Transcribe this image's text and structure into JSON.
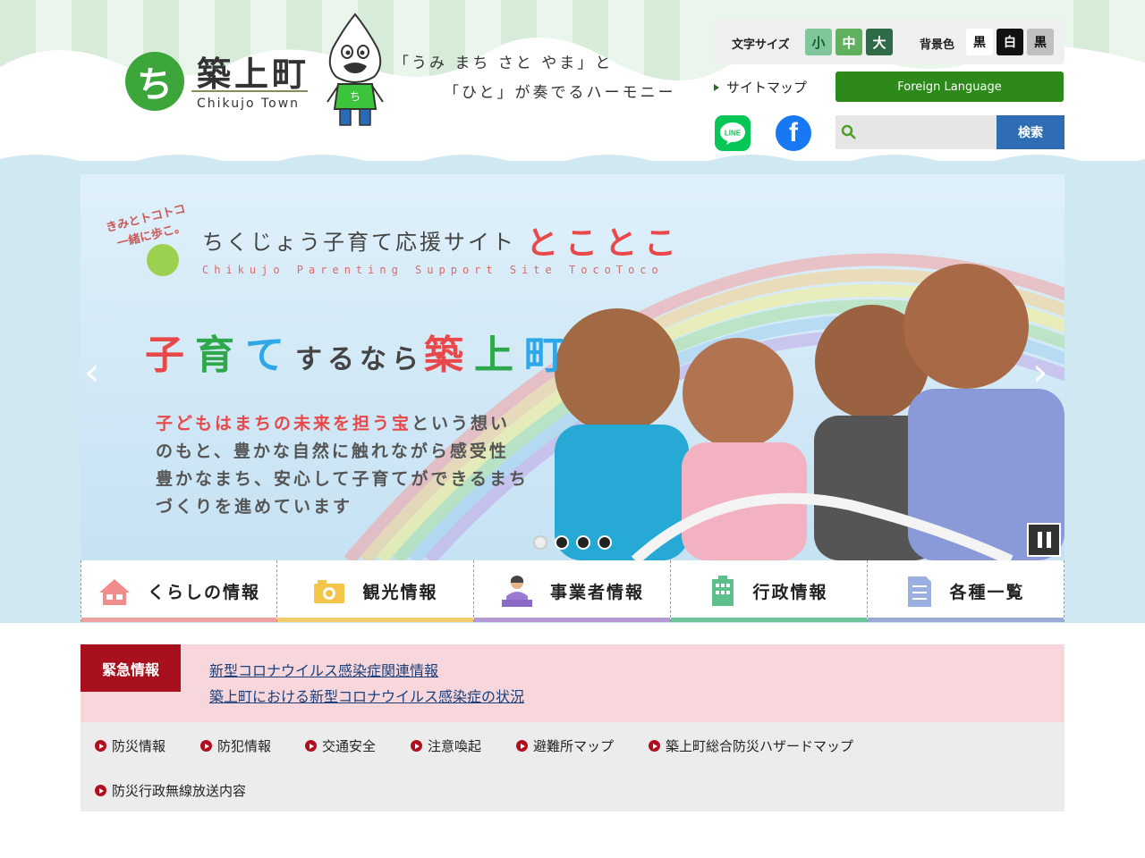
{
  "site": {
    "logo_name": "築上町",
    "logo_sub": "Chikujo Town",
    "catch_line1": "「うみ まち さと やま」と",
    "catch_line2": "「ひと」が奏でるハーモニー"
  },
  "tools": {
    "font_size_label": "文字サイズ",
    "font_sizes": [
      "小",
      "中",
      "大"
    ],
    "bg_label": "背景色",
    "bg_options": [
      "黒",
      "白",
      "黒"
    ],
    "sitemap": "サイトマップ",
    "foreign_language": "Foreign Language",
    "line_text": "LINE",
    "fb_text": "f",
    "search_placeholder": "",
    "search_button": "検索"
  },
  "slider": {
    "tagline1": "きみとトコトコ",
    "tagline2": "一緒に歩こ。",
    "site_name": "ちくじょう子育て応援サイト",
    "site_name_kana": "とことこ",
    "site_en": "Chikujo Parenting Support Site   TocoToco",
    "head_a": "子",
    "head_b": "育",
    "head_c": "て",
    "head_d": "するなら",
    "head_e": "築",
    "head_f": "上",
    "head_g": "町",
    "body_hl": "子どもはまちの未来を担う宝",
    "body1_rest": "という想い",
    "body2": "のもと、豊かな自然に触れながら感受性",
    "body3": "豊かなまち、安心して子育てができるまち",
    "body4": "づくりを進めています",
    "prev": "‹",
    "next": "›",
    "slide_count": 4,
    "active_slide": 1
  },
  "nav": {
    "items": [
      {
        "label": "くらしの情報",
        "icon": "house-icon",
        "color": "#f0a0a0"
      },
      {
        "label": "観光情報",
        "icon": "camera-icon",
        "color": "#f3cc70"
      },
      {
        "label": "事業者情報",
        "icon": "businessperson-icon",
        "color": "#b59ad6"
      },
      {
        "label": "行政情報",
        "icon": "building-icon",
        "color": "#6cc49a"
      },
      {
        "label": "各種一覧",
        "icon": "list-document-icon",
        "color": "#9aa9d6"
      }
    ]
  },
  "emergency": {
    "label": "緊急情報",
    "links": [
      "新型コロナウイルス感染症関連情報",
      "築上町における新型コロナウイルス感染症の状況"
    ]
  },
  "disaster": {
    "links": [
      "防災情報",
      "防犯情報",
      "交通安全",
      "注意喚起",
      "避難所マップ",
      "築上町総合防災ハザードマップ",
      "防災行政無線放送内容"
    ]
  },
  "colors": {
    "brand_green": "#3ca63a",
    "foreign_btn": "#2d8a1a",
    "search_btn": "#2e6db3",
    "emergency_red": "#a8101e",
    "emergency_bg": "#f7d7dc"
  }
}
